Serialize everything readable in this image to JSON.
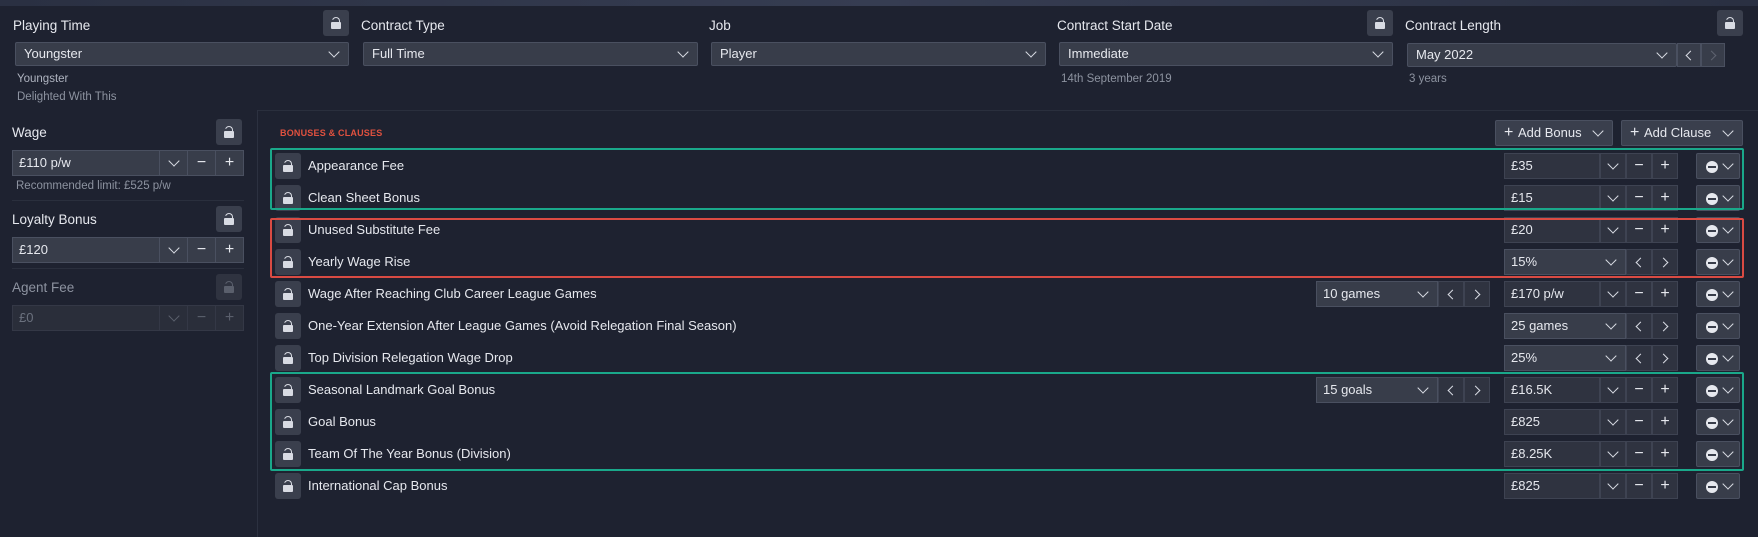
{
  "top": {
    "playing_time": {
      "label": "Playing Time",
      "value": "Youngster",
      "sub1": "Youngster",
      "sub2": "Delighted With This"
    },
    "contract_type": {
      "label": "Contract Type",
      "value": "Full Time"
    },
    "job": {
      "label": "Job",
      "value": "Player"
    },
    "contract_start": {
      "label": "Contract Start Date",
      "value": "Immediate",
      "sub1": "14th September 2019"
    },
    "contract_length": {
      "label": "Contract Length",
      "value": "May 2022",
      "sub1": "3 years"
    }
  },
  "left": {
    "wage": {
      "label": "Wage",
      "value": "£110 p/w",
      "note": "Recommended limit: £525 p/w"
    },
    "loyalty": {
      "label": "Loyalty Bonus",
      "value": "£120"
    },
    "agent": {
      "label": "Agent Fee",
      "value": "£0"
    }
  },
  "main": {
    "section_title": "BONUSES & CLAUSES",
    "add_bonus": "Add Bonus",
    "add_clause": "Add Clause",
    "rows": [
      {
        "label": "Appearance Fee",
        "value": "£35",
        "kind": "stepper"
      },
      {
        "label": "Clean Sheet Bonus",
        "value": "£15",
        "kind": "stepper"
      },
      {
        "label": "Unused Substitute Fee",
        "value": "£20",
        "kind": "stepper"
      },
      {
        "label": "Yearly Wage Rise",
        "value": "15%",
        "kind": "select"
      },
      {
        "label": "Wage After Reaching Club Career League Games",
        "value": "£170 p/w",
        "extra": "10 games",
        "kind": "stepper"
      },
      {
        "label": "One-Year Extension After League Games (Avoid Relegation Final Season)",
        "value": "25 games",
        "kind": "select"
      },
      {
        "label": "Top Division Relegation Wage Drop",
        "value": "25%",
        "kind": "select"
      },
      {
        "label": "Seasonal Landmark Goal Bonus",
        "value": "£16.5K",
        "extra": "15 goals",
        "kind": "stepper"
      },
      {
        "label": "Goal Bonus",
        "value": "£825",
        "kind": "stepper"
      },
      {
        "label": "Team Of The Year Bonus (Division)",
        "value": "£8.25K",
        "kind": "stepper"
      },
      {
        "label": "International Cap Bonus",
        "value": "£825",
        "kind": "stepper"
      }
    ]
  },
  "colors": {
    "highlight_green": "#1aa88a",
    "highlight_red": "#d94b43",
    "section_title": "#e0513f"
  },
  "icons": [
    "lock-icon",
    "chevron-down-icon",
    "minus-icon",
    "plus-icon",
    "arrow-left-icon",
    "arrow-right-icon",
    "remove-circle-icon"
  ]
}
